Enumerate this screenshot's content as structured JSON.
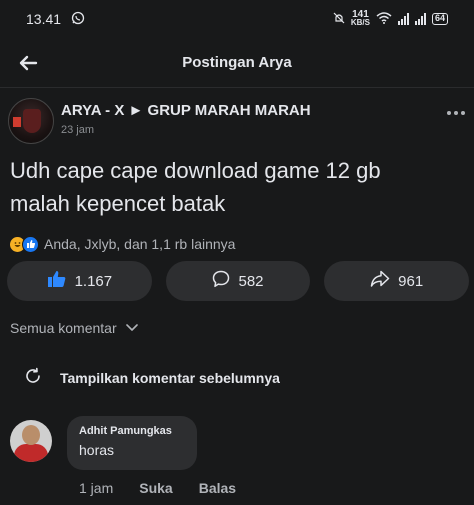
{
  "status": {
    "time": "13.41",
    "net_speed_value": "141",
    "net_speed_unit": "KB/S",
    "battery": "64",
    "icons": [
      "whatsapp-icon",
      "alarm-off-icon",
      "wifi-icon",
      "signal-icon",
      "battery-icon"
    ]
  },
  "header": {
    "title": "Postingan Arya"
  },
  "post": {
    "author": "ARYA - X ► GRUP MARAH MARAH",
    "time": "23 jam",
    "text_line1": "Udh cape cape download game 12 gb",
    "text_line2": "malah kepencet batak",
    "reactions_summary": "Anda, Jxlyb, dan 1,1 rb lainnya"
  },
  "actions": {
    "likes": "1.167",
    "comments": "582",
    "shares": "961"
  },
  "comments_section": {
    "sort_label": "Semua komentar",
    "previous_label": "Tampilkan komentar sebelumnya"
  },
  "comment": {
    "name": "Adhit Pamungkas",
    "text": "horas",
    "time": "1 jam",
    "like_label": "Suka",
    "reply_label": "Balas"
  },
  "colors": {
    "background": "#18191a",
    "surface": "#2d2e30",
    "text": "#e4e6eb",
    "secondary_text": "#b0b3b8",
    "like_blue": "#1877f2"
  }
}
